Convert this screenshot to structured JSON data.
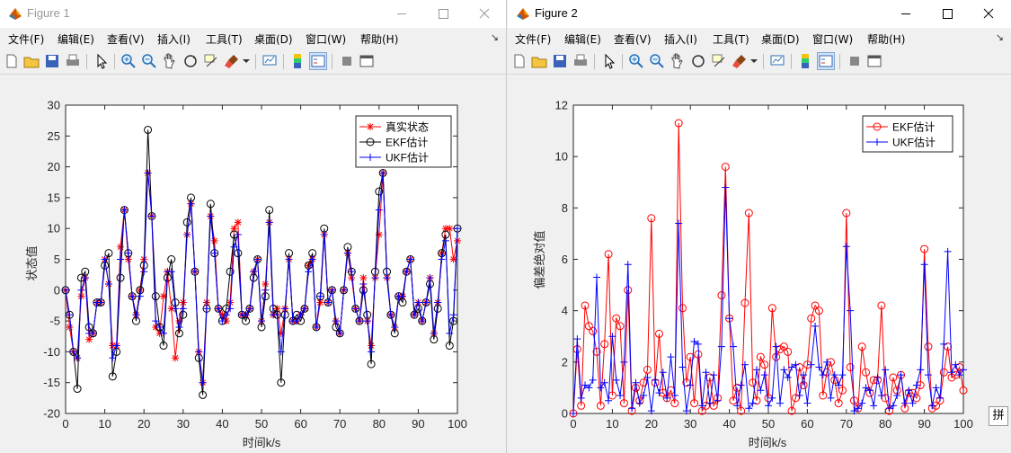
{
  "windows": [
    {
      "title": "Figure 1",
      "menu": [
        "文件(F)",
        "编辑(E)",
        "查看(V)",
        "插入(I)",
        "工具(T)",
        "桌面(D)",
        "窗口(W)",
        "帮助(H)"
      ],
      "dock_glyph": "↘",
      "chart_data": {
        "type": "line",
        "xlabel": "时间k/s",
        "ylabel": "状态值",
        "xlim": [
          0,
          100
        ],
        "ylim": [
          -20,
          30
        ],
        "xticks": [
          0,
          10,
          20,
          30,
          40,
          50,
          60,
          70,
          80,
          90,
          100
        ],
        "yticks": [
          -20,
          -15,
          -10,
          -5,
          0,
          5,
          10,
          15,
          20,
          25,
          30
        ],
        "grid": false,
        "legend_position": "top-right",
        "x": [
          0,
          1,
          2,
          3,
          4,
          5,
          6,
          7,
          8,
          9,
          10,
          11,
          12,
          13,
          14,
          15,
          16,
          17,
          18,
          19,
          20,
          21,
          22,
          23,
          24,
          25,
          26,
          27,
          28,
          29,
          30,
          31,
          32,
          33,
          34,
          35,
          36,
          37,
          38,
          39,
          40,
          41,
          42,
          43,
          44,
          45,
          46,
          47,
          48,
          49,
          50,
          51,
          52,
          53,
          54,
          55,
          56,
          57,
          58,
          59,
          60,
          61,
          62,
          63,
          64,
          65,
          66,
          67,
          68,
          69,
          70,
          71,
          72,
          73,
          74,
          75,
          76,
          77,
          78,
          79,
          80,
          81,
          82,
          83,
          84,
          85,
          86,
          87,
          88,
          89,
          90,
          91,
          92,
          93,
          94,
          95,
          96,
          97,
          98,
          99,
          100
        ],
        "series": [
          {
            "name": "真实状态",
            "color": "#ff0000",
            "marker": "star",
            "values": [
              0,
              -6,
              -10,
              -11,
              -1,
              2,
              -8,
              -7,
              -2,
              -2,
              5,
              1,
              -9,
              -9,
              7,
              13,
              5,
              -1,
              -4,
              0,
              5,
              19,
              12,
              -6,
              -7,
              -1,
              3,
              -3,
              -11,
              -5,
              -2,
              9,
              14,
              3,
              -10,
              -15,
              -2,
              12,
              8,
              -3,
              -4,
              -5,
              -2,
              10,
              11,
              -4,
              -4,
              -3,
              3,
              5,
              -5,
              1,
              11,
              -4,
              -3,
              -7,
              -3,
              5,
              -5,
              -5,
              -4,
              -3,
              4,
              5,
              -6,
              -2,
              9,
              -2,
              0,
              -5,
              -7,
              0,
              6,
              2,
              -3,
              -5,
              2,
              -5,
              -9,
              2,
              9,
              19,
              2,
              -4,
              -6,
              -1,
              -1,
              3,
              5,
              -4,
              -2,
              -5,
              -2,
              2,
              -7,
              -2,
              6,
              10,
              10,
              5,
              8,
              10
            ]
          },
          {
            "name": "EKF估计",
            "color": "#000000",
            "marker": "circle",
            "values": [
              0,
              -4,
              -10,
              -16,
              2,
              3,
              -6,
              -7,
              -2,
              -2,
              4,
              6,
              -14,
              -10,
              2,
              13,
              6,
              -1,
              -5,
              0,
              4,
              26,
              12,
              -1,
              -6,
              -9,
              2,
              5,
              -2,
              -7,
              -4,
              11,
              15,
              3,
              -11,
              -17,
              -3,
              14,
              6,
              -3,
              -5,
              -3,
              3,
              9,
              6,
              -4,
              -5,
              -3,
              2,
              5,
              -6,
              -1,
              13,
              -3,
              -4,
              -15,
              -4,
              6,
              -5,
              -4,
              -5,
              -3,
              4,
              6,
              -6,
              -1,
              10,
              -2,
              0,
              -6,
              -7,
              0,
              7,
              3,
              -3,
              -5,
              0,
              -4,
              -12,
              3,
              16,
              19,
              3,
              -4,
              -7,
              -1,
              -2,
              3,
              5,
              -4,
              -3,
              -5,
              -2,
              1,
              -8,
              -3,
              6,
              9,
              -9,
              -5,
              10
            ]
          },
          {
            "name": "UKF估计",
            "color": "#0000ff",
            "marker": "plus",
            "values": [
              0,
              -4,
              -10,
              -11,
              0,
              2,
              -7,
              -7,
              -2,
              -2,
              5,
              1,
              -11,
              -9,
              5,
              13,
              6,
              -1,
              -4,
              -1,
              3,
              19,
              12,
              -5,
              -6,
              -7,
              3,
              3,
              -3,
              -6,
              -3,
              9,
              14,
              3,
              -10,
              -15,
              -3,
              12,
              6,
              -3,
              -5,
              -4,
              -3,
              7,
              9,
              -4,
              -4,
              -3,
              3,
              5,
              -5,
              0,
              11,
              -4,
              -4,
              -10,
              -3,
              5,
              -5,
              -5,
              -4,
              -3,
              3,
              5,
              -6,
              -1,
              9,
              -2,
              0,
              -5,
              -7,
              0,
              6,
              3,
              -3,
              -5,
              1,
              -5,
              -10,
              2,
              13,
              19,
              2,
              -4,
              -6,
              -1,
              -1,
              3,
              5,
              -4,
              -2,
              -5,
              -2,
              2,
              -7,
              -2,
              5,
              8,
              -7,
              -4,
              10
            ]
          }
        ]
      }
    },
    {
      "title": "Figure 2",
      "menu": [
        "文件(F)",
        "编辑(E)",
        "查看(V)",
        "插入(I)",
        "工具(T)",
        "桌面(D)",
        "窗口(W)",
        "帮助(H)"
      ],
      "dock_glyph": "↘",
      "chart_data": {
        "type": "line",
        "xlabel": "时间k/s",
        "ylabel": "偏差绝对值",
        "xlim": [
          0,
          100
        ],
        "ylim": [
          0,
          12
        ],
        "xticks": [
          0,
          10,
          20,
          30,
          40,
          50,
          60,
          70,
          80,
          90,
          100
        ],
        "yticks": [
          0,
          2,
          4,
          6,
          8,
          10,
          12
        ],
        "grid": false,
        "legend_position": "top-right",
        "x": [
          0,
          1,
          2,
          3,
          4,
          5,
          6,
          7,
          8,
          9,
          10,
          11,
          12,
          13,
          14,
          15,
          16,
          17,
          18,
          19,
          20,
          21,
          22,
          23,
          24,
          25,
          26,
          27,
          28,
          29,
          30,
          31,
          32,
          33,
          34,
          35,
          36,
          37,
          38,
          39,
          40,
          41,
          42,
          43,
          44,
          45,
          46,
          47,
          48,
          49,
          50,
          51,
          52,
          53,
          54,
          55,
          56,
          57,
          58,
          59,
          60,
          61,
          62,
          63,
          64,
          65,
          66,
          67,
          68,
          69,
          70,
          71,
          72,
          73,
          74,
          75,
          76,
          77,
          78,
          79,
          80,
          81,
          82,
          83,
          84,
          85,
          86,
          87,
          88,
          89,
          90,
          91,
          92,
          93,
          94,
          95,
          96,
          97,
          98,
          99,
          100
        ],
        "series": [
          {
            "name": "EKF估计",
            "color": "#ff0000",
            "marker": "circle",
            "values": [
              0,
              2.5,
              0.3,
              4.2,
              3.4,
              3.2,
              2.4,
              0.3,
              2.7,
              6.2,
              0.7,
              3.7,
              3.4,
              0.4,
              4.8,
              0.1,
              1.0,
              0.5,
              1.2,
              1.7,
              7.6,
              1.2,
              3.1,
              0.8,
              0.6,
              0.9,
              0.4,
              11.3,
              4.1,
              1.2,
              2.2,
              0.4,
              2.3,
              0.1,
              0.3,
              1.4,
              0.3,
              0.6,
              4.6,
              9.6,
              3.7,
              0.5,
              1.0,
              0.1,
              4.3,
              7.8,
              1.2,
              0.5,
              2.2,
              1.9,
              0.6,
              4.1,
              2.2,
              2.5,
              2.6,
              2.4,
              0.1,
              0.6,
              1.8,
              1.1,
              1.9,
              3.7,
              4.2,
              4.0,
              0.7,
              1.6,
              2.0,
              1.3,
              0.4,
              0.9,
              7.8,
              1.8,
              0.5,
              0.2,
              2.6,
              1.6,
              0.8,
              1.3,
              1.3,
              4.2,
              0.6,
              0.1,
              1.4,
              0.9,
              1.5,
              0.2,
              0.8,
              0.8,
              0.6,
              1.1,
              6.4,
              2.6,
              0.2,
              0.3,
              0.5,
              1.6,
              2.6,
              1.4,
              1.5,
              1.8,
              0.9
            ]
          },
          {
            "name": "UKF估计",
            "color": "#0000ff",
            "marker": "plus",
            "values": [
              0,
              2.9,
              0.6,
              1.1,
              1.0,
              1.3,
              5.3,
              1.0,
              1.2,
              0.5,
              3.0,
              1.3,
              0.7,
              2.0,
              5.8,
              0.2,
              1.2,
              0.4,
              0.7,
              1.4,
              0.1,
              1.3,
              0.8,
              1.6,
              0.6,
              2.2,
              0.7,
              7.4,
              1.8,
              0.1,
              1.1,
              2.8,
              2.7,
              0.3,
              1.6,
              0.4,
              1.5,
              0.5,
              2.6,
              8.8,
              3.7,
              2.6,
              0.3,
              1.1,
              1.9,
              0.2,
              0.4,
              1.7,
              0.9,
              1.5,
              0.3,
              0.6,
              2.6,
              0.4,
              1.7,
              1.4,
              1.8,
              1.9,
              0.7,
              1.5,
              0.4,
              1.9,
              3.4,
              1.8,
              1.5,
              2.0,
              0.6,
              1.5,
              1.1,
              1.5,
              6.5,
              4.0,
              0.1,
              0.2,
              0.4,
              1.0,
              0.9,
              0.3,
              1.4,
              0.7,
              1.7,
              0.2,
              0.3,
              0.7,
              1.5,
              0.4,
              0.9,
              0.4,
              1.1,
              1.7,
              5.8,
              1.5,
              0.3,
              1.0,
              0.6,
              2.7,
              6.3,
              1.6,
              1.9,
              1.5,
              1.7
            ]
          }
        ]
      }
    }
  ],
  "ime_indicator": "拼"
}
